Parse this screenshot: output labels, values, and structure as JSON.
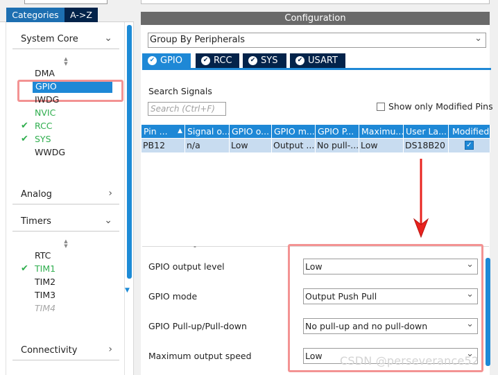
{
  "left_panel": {
    "tabs": [
      "Categories",
      "A->Z"
    ],
    "sections": {
      "system_core": "System Core",
      "analog": "Analog",
      "timers": "Timers",
      "connectivity": "Connectivity"
    },
    "system_core_items": [
      {
        "label": "DMA",
        "state": "normal"
      },
      {
        "label": "GPIO",
        "state": "selected"
      },
      {
        "label": "IWDG",
        "state": "normal"
      },
      {
        "label": "NVIC",
        "state": "green"
      },
      {
        "label": "RCC",
        "state": "configured"
      },
      {
        "label": "SYS",
        "state": "configured"
      },
      {
        "label": "WWDG",
        "state": "normal"
      }
    ],
    "timer_items": [
      {
        "label": "RTC",
        "state": "normal"
      },
      {
        "label": "TIM1",
        "state": "configured"
      },
      {
        "label": "TIM2",
        "state": "normal"
      },
      {
        "label": "TIM3",
        "state": "normal"
      },
      {
        "label": "TIM4",
        "state": "disabled"
      }
    ]
  },
  "configuration": {
    "header": "Configuration",
    "group_by": "Group By Peripherals",
    "tabs": [
      "GPIO",
      "RCC",
      "SYS",
      "USART"
    ],
    "active_tab": "GPIO",
    "search_label": "Search Signals",
    "search_placeholder": "Search (Ctrl+F)",
    "show_modified_label": "Show only Modified Pins",
    "table": {
      "columns": [
        "Pin ...",
        "Signal o...",
        "GPIO o...",
        "GPIO m...",
        "GPIO P...",
        "Maximu...",
        "User La...",
        "Modified"
      ],
      "rows": [
        [
          "PB12",
          "n/a",
          "Low",
          "Output ...",
          "No pull-...",
          "Low",
          "DS18B20",
          "checked"
        ]
      ]
    },
    "form": {
      "fields": [
        {
          "label": "GPIO output level",
          "value": "Low"
        },
        {
          "label": "GPIO mode",
          "value": "Output Push Pull"
        },
        {
          "label": "GPIO Pull-up/Pull-down",
          "value": "No pull-up and no pull-down"
        },
        {
          "label": "Maximum output speed",
          "value": "Low"
        }
      ]
    }
  },
  "watermark": "CSDN @perseverance52",
  "colors": {
    "accent_blue": "#1e88d6",
    "dark_navy": "#03234a",
    "configured_green": "#2fae4e",
    "highlight_red": "#f39393",
    "arrow_red": "#e8221e"
  }
}
